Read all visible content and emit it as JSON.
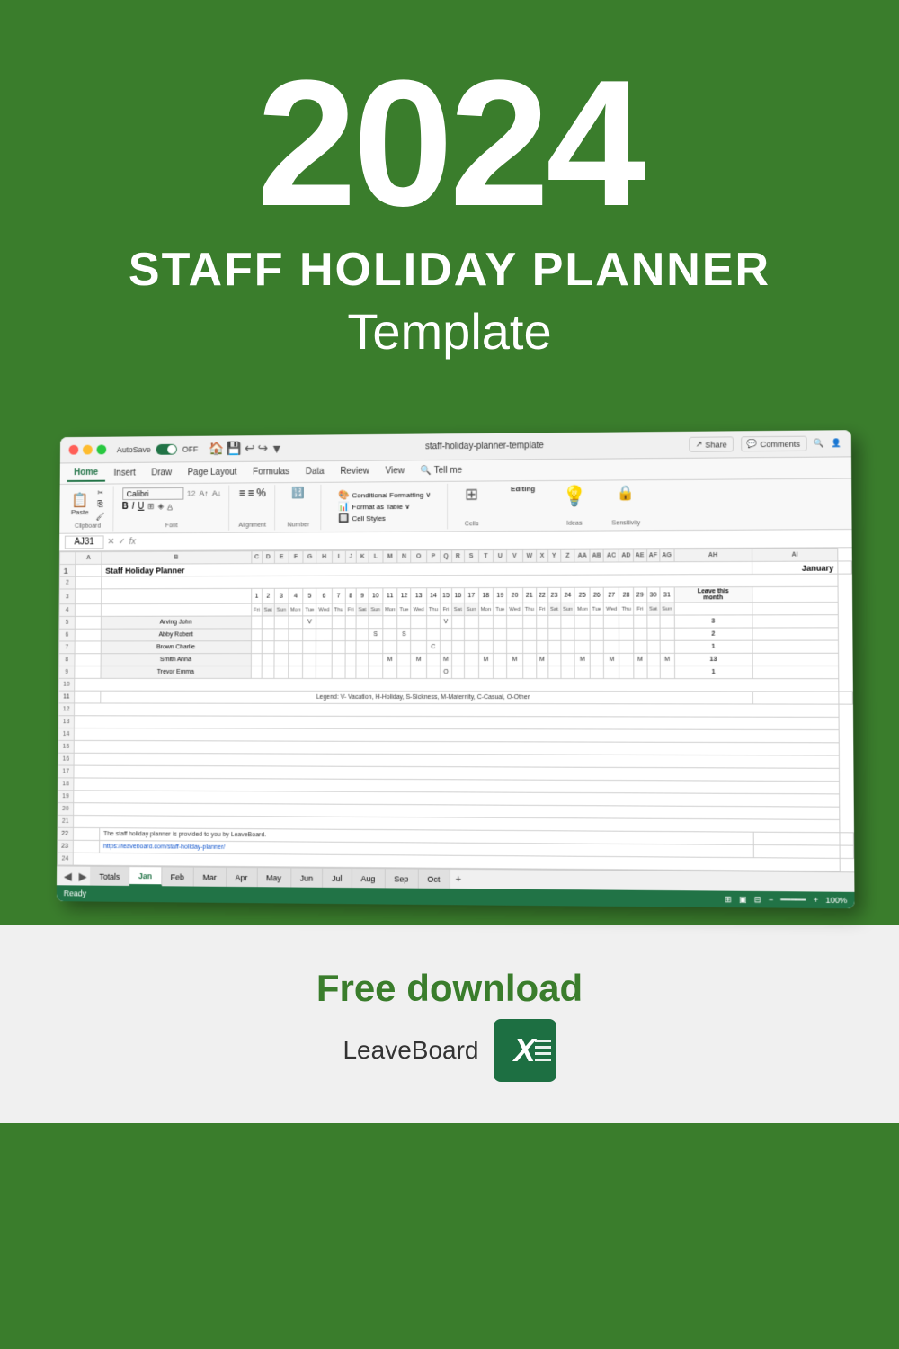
{
  "header": {
    "year": "2024",
    "line1": "STAFF HOLIDAY PLANNER",
    "line2": "Template"
  },
  "spreadsheet": {
    "title_bar": {
      "filename": "staff-holiday-planner-template"
    },
    "ribbon": {
      "tabs": [
        "Home",
        "Insert",
        "Draw",
        "Page Layout",
        "Formulas",
        "Data",
        "Review",
        "View",
        "Tell me"
      ],
      "active_tab": "Home",
      "font_name": "Calibri",
      "font_size": "12",
      "autosave_label": "AutoSave",
      "autosave_state": "OFF"
    },
    "formula_bar": {
      "cell_ref": "AJ31",
      "formula": ""
    },
    "sheet": {
      "title": "Staff Holiday Planner",
      "month": "January",
      "names": [
        "Arving John",
        "Abby Robert",
        "Brown Charlie",
        "Smith Anna",
        "Trevor Emma"
      ],
      "leave_this_month": [
        3,
        2,
        1,
        13,
        1
      ],
      "legend": "Legend: V- Vacation, H-Holiday, S-Sickness, M-Maternity, C-Casual, O-Other",
      "credit": "The staff holiday planner is provided to you by LeaveBoard.",
      "credit_link": "https://leaveboard.com/staff-holiday-planner/"
    },
    "tabs": [
      "Totals",
      "Jan",
      "Feb",
      "Mar",
      "Apr",
      "May",
      "Jun",
      "Jul",
      "Aug",
      "Sep",
      "Oct"
    ],
    "status": {
      "left": "Ready",
      "zoom": "100%"
    }
  },
  "footer": {
    "free_download": "Free download",
    "brand": "LeaveBoard"
  },
  "editing_label": "Editing",
  "share_label": "Share",
  "comments_label": "Comments",
  "cells_label": "Cells",
  "ideas_label": "Ideas",
  "sensitivity_label": "Sensitivity",
  "alignment_label": "Alignment",
  "number_label": "Number",
  "cell_styles_label": "Cell Styles"
}
